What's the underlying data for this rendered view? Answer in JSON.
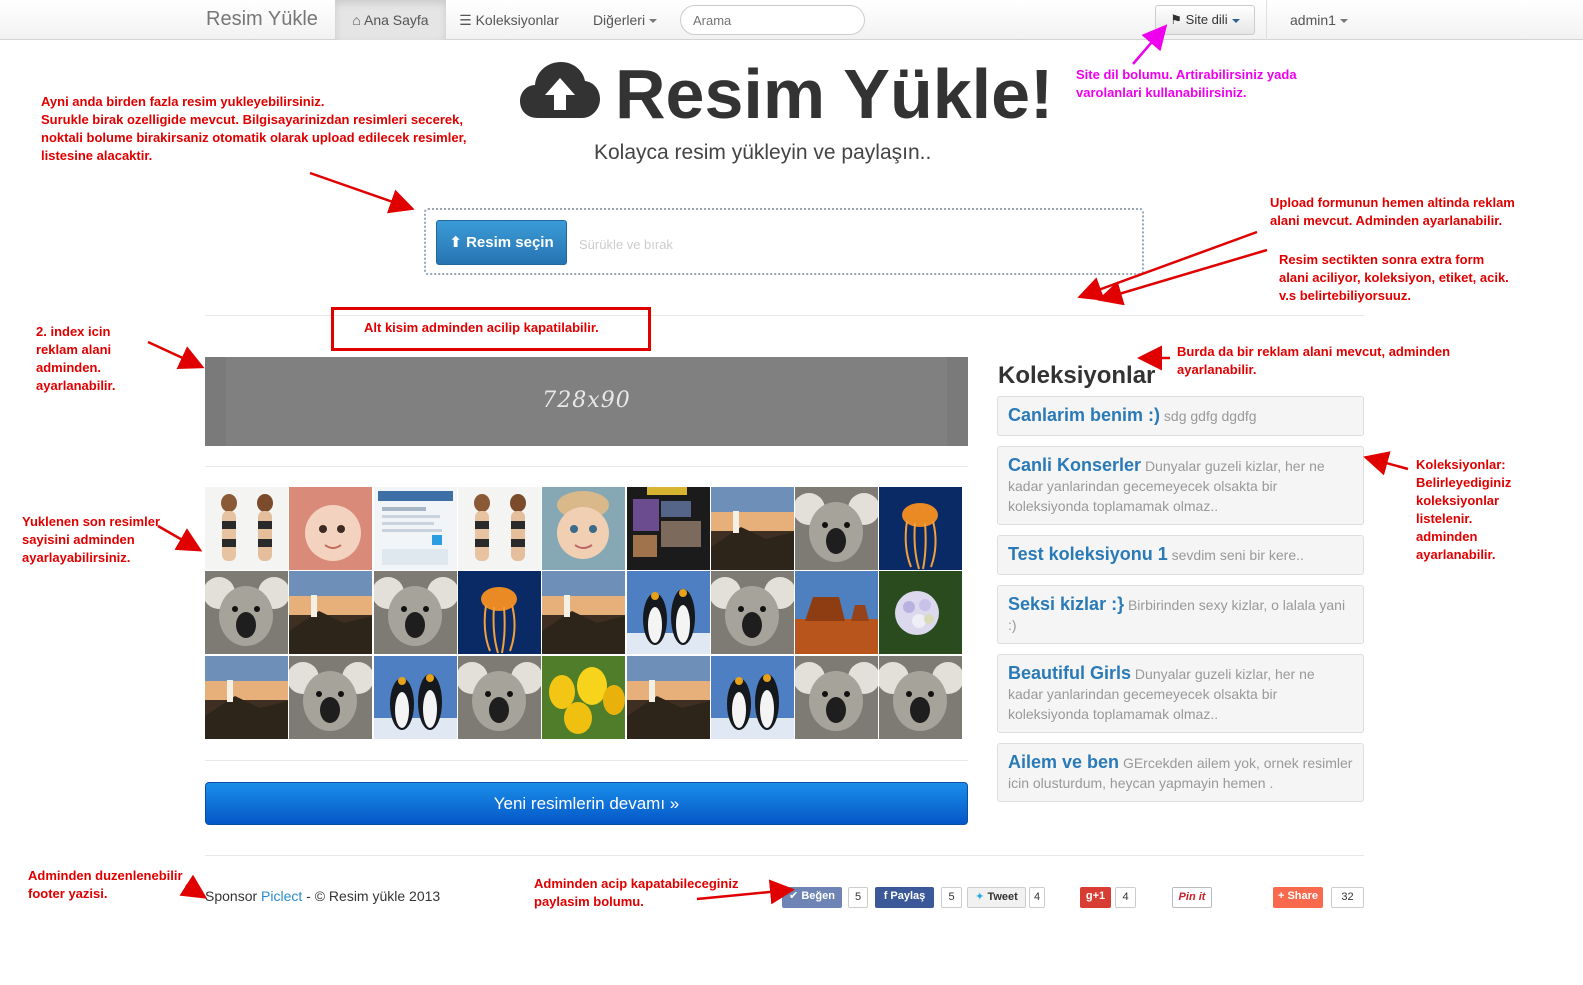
{
  "navbar": {
    "brand": "Resim Yükle",
    "home_label": "Ana Sayfa",
    "collections_label": "Koleksiyonlar",
    "others_label": "Diğerleri",
    "search_placeholder": "Arama",
    "language_label": "Site dili",
    "user_label": "admin1"
  },
  "hero": {
    "title": "Resim Yükle!",
    "subtitle": "Kolayca resim yükleyin ve paylaşın..",
    "upload_button": "Resim seçin",
    "drop_hint": "Sürükle ve bırak"
  },
  "ad": {
    "label": "728x90"
  },
  "more_button": "Yeni resimlerin devamı »",
  "collections": {
    "title": "Koleksiyonlar",
    "items": [
      {
        "name": "Canlarim benim :)",
        "desc": "sdg gdfg dgdfg"
      },
      {
        "name": "Canli Konserler",
        "desc": "Dunyalar guzeli kizlar, her ne kadar yanlarindan gecemeyecek olsakta bir koleksiyonda toplamamak olmaz.."
      },
      {
        "name": "Test koleksiyonu 1",
        "desc": "sevdim seni bir kere.."
      },
      {
        "name": "Seksi kizlar :}",
        "desc": "Birbirinden sexy kizlar, o lalala yani :)"
      },
      {
        "name": "Beautiful Girls",
        "desc": "Dunyalar guzeli kizlar, her ne kadar yanlarindan gecemeyecek olsakta bir koleksiyonda toplamamak olmaz.."
      },
      {
        "name": "Ailem ve ben",
        "desc": "GErcekden ailem yok, ornek resimler icin olusturdum, heycan yapmayin hemen ."
      }
    ]
  },
  "thumbnails": [
    "girl-bikini",
    "baby",
    "screenshot",
    "girl-bikini",
    "child",
    "collage",
    "lighthouse",
    "koala",
    "jellyfish",
    "koala",
    "lighthouse",
    "koala",
    "jellyfish",
    "lighthouse",
    "penguins",
    "koala",
    "desert",
    "hydrangea",
    "lighthouse",
    "koala",
    "penguins",
    "koala",
    "tulips",
    "lighthouse",
    "penguins",
    "koala",
    "koala"
  ],
  "footer": {
    "prefix": "Sponsor ",
    "link": "Piclect",
    "suffix": " - © Resim yükle 2013"
  },
  "share": {
    "like_label": "Beğen",
    "like_count": "5",
    "fb_label": "Paylaş",
    "fb_count": "5",
    "tweet_label": "Tweet",
    "tweet_count": "4",
    "gplus_label": "g+1",
    "gplus_count": "4",
    "pinit_label": "Pin it",
    "share_label": "Share",
    "share_count": "32"
  },
  "annotations": {
    "multi_upload": "Ayni anda birden fazla resim yukleyebilirsiniz.\nSurukle birak ozelligide mevcut. Bilgisayarinizdan resimleri secerek,\nnoktali bolume birakirsaniz otomatik olarak upload edilecek resimler,\nlistesine alacaktir.",
    "site_lang": "Site dil bolumu. Artirabilirsiniz yada\nvarolanlari kullanabilirsiniz.",
    "upload_ad": "Upload formunun hemen altinda reklam\nalani mevcut. Adminden ayarlanabilir.",
    "extra_form": "Resim sectikten sonra extra form\nalani aciliyor, koleksiyon, etiket, acik.\nv.s belirtebiliyorsuuz.",
    "toggle_bottom": "Alt kisim adminden acilip kapatilabilir.",
    "index_ad": "2. index icin\nreklam alani\nadminden.\nayarlanabilir.",
    "side_ad": "Burda da bir reklam alani mevcut, adminden\nayarlanabilir.",
    "collections_note": "Koleksiyonlar:\nBelirleyediginiz\nkoleksiyonlar\nlistelenir.\nadminden\nayarlanabilir.",
    "last_images": "Yuklenen son resimler\nsayisini adminden\nayarlayabilirsiniz.",
    "footer_note": "Adminden duzenlenebilir\nfooter yazisi.",
    "share_note": "Adminden acip kapatabileceginiz\npaylasim bolumu."
  },
  "colors": {
    "annotation": "#e00000",
    "annotation_pink": "#ee00ee",
    "primary_button": "#2774b2",
    "more_button": "#0557c8",
    "link": "#2a7ab8"
  }
}
